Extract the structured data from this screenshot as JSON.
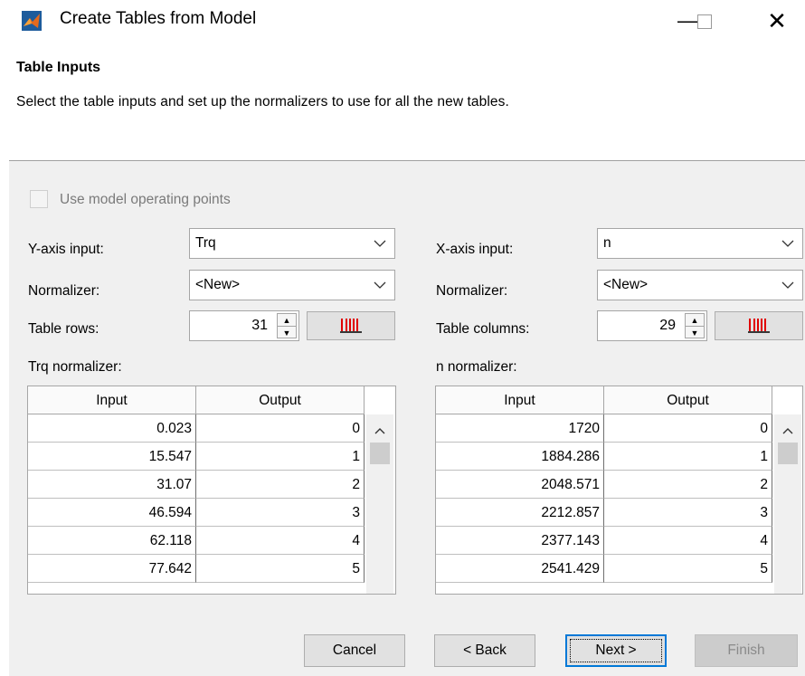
{
  "window": {
    "title": "Create Tables from Model",
    "icon": "matlab-icon",
    "controls": {
      "minimize": "—",
      "maximize": "□",
      "close": "✕"
    }
  },
  "header": {
    "title": "Table Inputs",
    "subtitle": "Select the table inputs and set up the normalizers to use for all the new tables."
  },
  "options": {
    "use_model_operating_points": {
      "label": "Use model operating points",
      "checked": false,
      "enabled": false
    }
  },
  "y_axis": {
    "input_label": "Y-axis input:",
    "input_value": "Trq",
    "normalizer_label": "Normalizer:",
    "normalizer_value": "<New>",
    "count_label": "Table rows:",
    "count_value": "31",
    "normalizer_table_label": "Trq normalizer:",
    "table": {
      "columns": [
        "Input",
        "Output"
      ],
      "rows": [
        [
          "0.023",
          "0"
        ],
        [
          "15.547",
          "1"
        ],
        [
          "31.07",
          "2"
        ],
        [
          "46.594",
          "3"
        ],
        [
          "62.118",
          "4"
        ],
        [
          "77.642",
          "5"
        ]
      ]
    }
  },
  "x_axis": {
    "input_label": "X-axis input:",
    "input_value": "n",
    "normalizer_label": "Normalizer:",
    "normalizer_value": "<New>",
    "count_label": "Table columns:",
    "count_value": "29",
    "normalizer_table_label": "n normalizer:",
    "table": {
      "columns": [
        "Input",
        "Output"
      ],
      "rows": [
        [
          "1720",
          "0"
        ],
        [
          "1884.286",
          "1"
        ],
        [
          "2048.571",
          "2"
        ],
        [
          "2212.857",
          "3"
        ],
        [
          "2377.143",
          "4"
        ],
        [
          "2541.429",
          "5"
        ]
      ]
    }
  },
  "footer": {
    "cancel": "Cancel",
    "back": "< Back",
    "next": "Next >",
    "finish": "Finish"
  },
  "colors": {
    "focus": "#0078d7",
    "panel": "#f0f0f0",
    "icon_red": "#e00000"
  }
}
